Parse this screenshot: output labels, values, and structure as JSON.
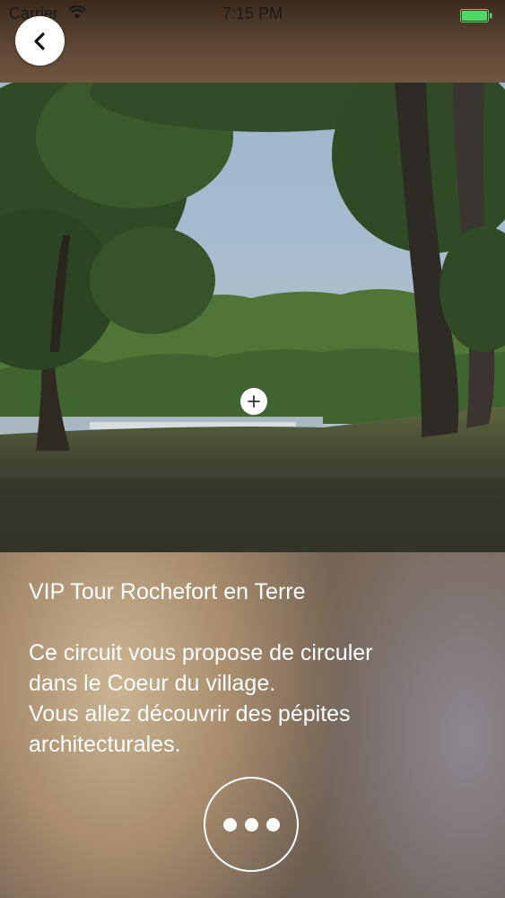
{
  "status_bar": {
    "carrier": "Carrier",
    "time": "7:15 PM",
    "battery_color": "#4cd964"
  },
  "navigation": {
    "back_icon": "chevron-left-icon"
  },
  "photo": {
    "zoom_icon": "plus-icon"
  },
  "tour": {
    "title": "VIP Tour Rochefort en Terre",
    "description_lines": [
      "Ce circuit vous propose de circuler",
      "dans le Coeur du village.",
      "Vous allez découvrir des pépites",
      "architecturales."
    ]
  },
  "actions": {
    "more_icon": "more-dots-icon"
  }
}
